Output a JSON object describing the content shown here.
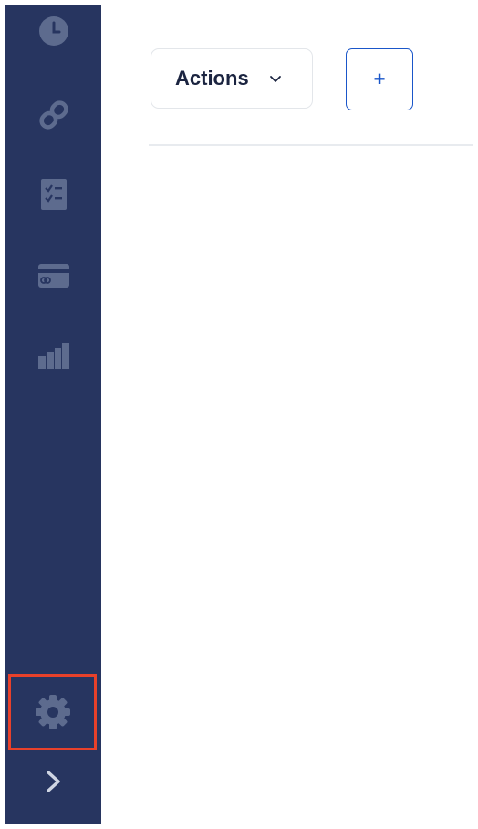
{
  "sidebar": {
    "items": [
      {
        "icon": "clock-icon"
      },
      {
        "icon": "link-icon"
      },
      {
        "icon": "checklist-icon"
      },
      {
        "icon": "credit-card-icon"
      },
      {
        "icon": "bar-chart-icon"
      }
    ],
    "settings": {
      "icon": "gear-icon",
      "highlight_color": "#e8412b"
    },
    "expand": {
      "icon": "chevron-right-icon"
    },
    "background_color": "#273560",
    "icon_color": "#5d6b8e"
  },
  "toolbar": {
    "actions_label": "Actions",
    "actions_icon": "chevron-down-icon",
    "add_label": "+",
    "accent_color": "#1a56c9"
  }
}
